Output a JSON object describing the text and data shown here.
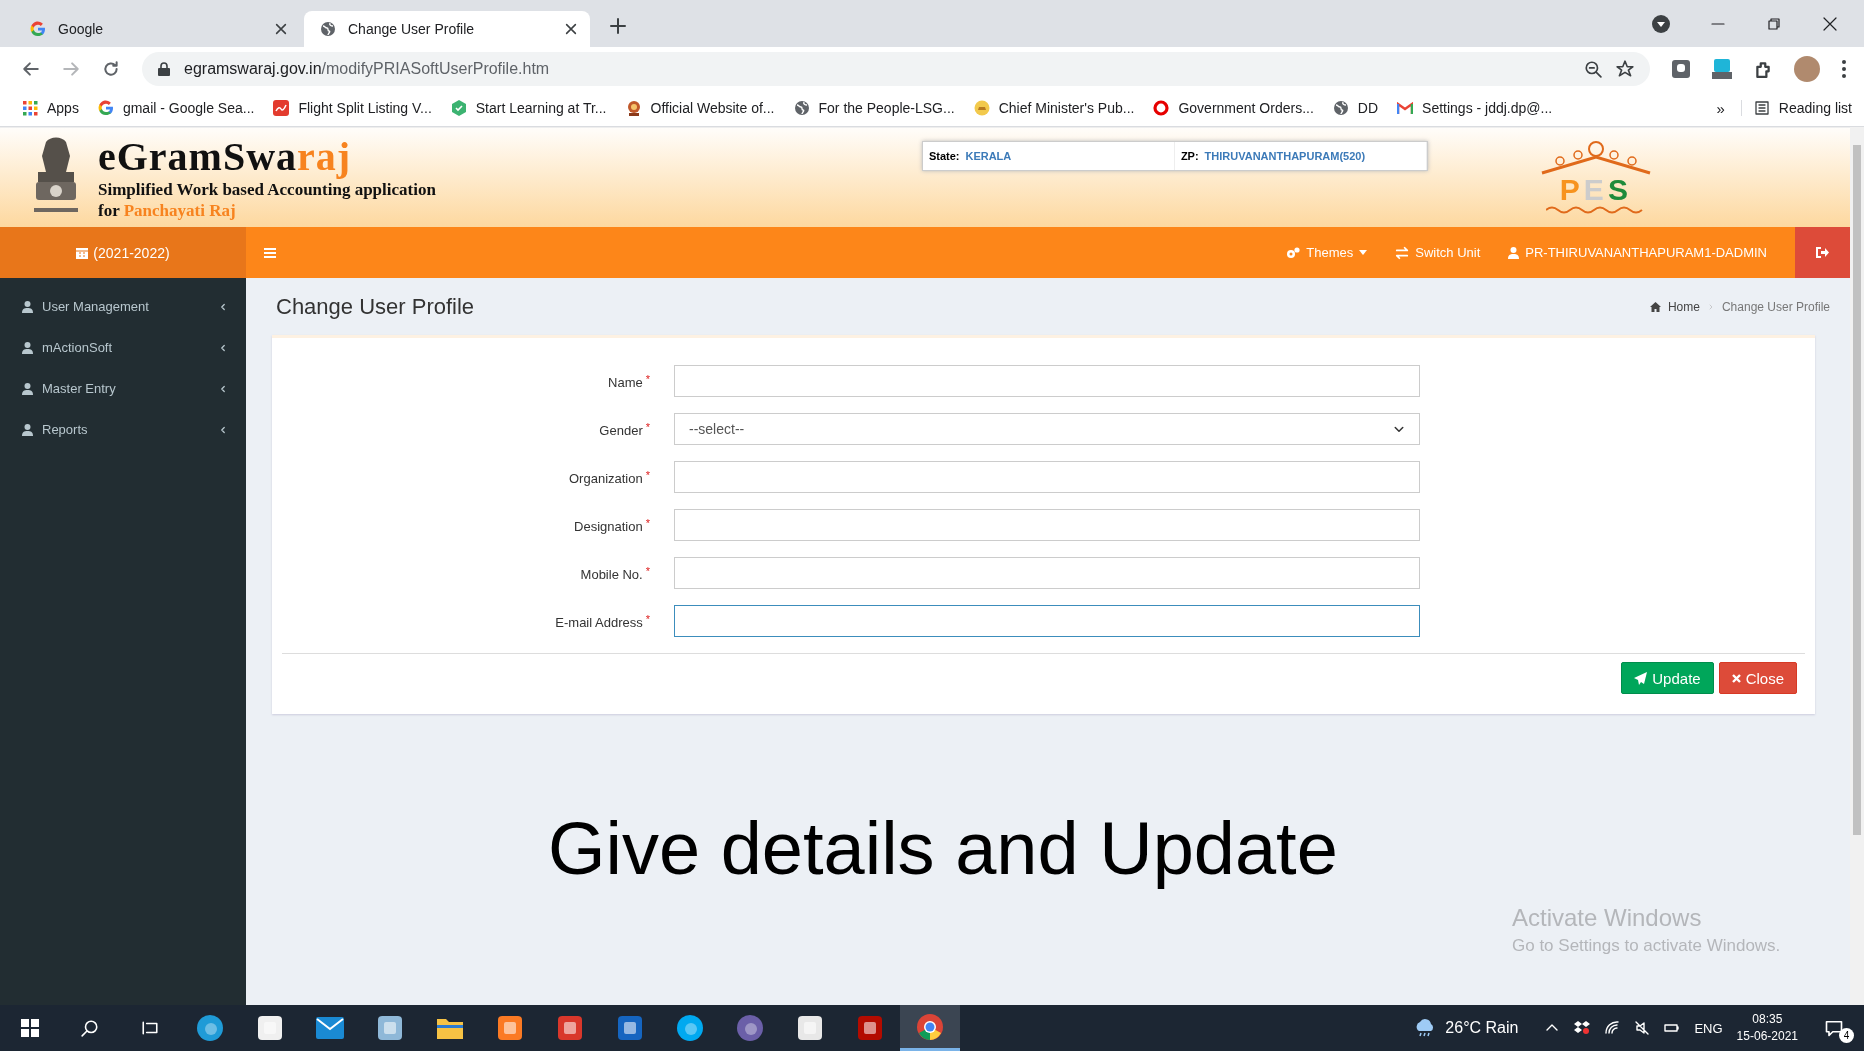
{
  "browser": {
    "tabs": [
      {
        "title": "Google",
        "kind": "google",
        "selected": false
      },
      {
        "title": "Change User Profile",
        "kind": "globe",
        "selected": true
      }
    ],
    "url": {
      "domain": "egramswaraj.gov.in",
      "path": "/modifyPRIASoftUserProfile.htm"
    },
    "bookmarks": [
      {
        "label": "Apps",
        "kind": "apps"
      },
      {
        "label": "gmail - Google Sea...",
        "kind": "google"
      },
      {
        "label": "Flight Split Listing V...",
        "kind": "square"
      },
      {
        "label": "Start Learning at Tr...",
        "kind": "hexagon"
      },
      {
        "label": "Official Website of...",
        "kind": "seal"
      },
      {
        "label": "For the People-LSG...",
        "kind": "globe"
      },
      {
        "label": "Chief Minister's Pub...",
        "kind": "coin"
      },
      {
        "label": "Government Orders...",
        "kind": "ring"
      },
      {
        "label": "DD",
        "kind": "globe"
      },
      {
        "label": "Settings - jddj.dp@...",
        "kind": "mail"
      }
    ],
    "bookmarks_more": "»",
    "reading_list": "Reading list"
  },
  "header": {
    "logo_main": "eGramSwa",
    "logo_accent": "raj",
    "tagline": "Simplified Work based Accounting application",
    "tagline_prefix": "for",
    "tagline_accent": "Panchayati Raj",
    "state_label": "State:",
    "state_value": "KERALA",
    "zp_label": "ZP:",
    "zp_value": "THIRUVANANTHAPURAM(520)",
    "pes_logo": "PES"
  },
  "nav": {
    "year": "(2021-2022)",
    "items": [
      {
        "label": "Themes",
        "kind": "dropdown"
      },
      {
        "label": "Switch Unit",
        "kind": "switch"
      },
      {
        "label": "PR-THIRUVANANTHAPURAM1-DADMIN",
        "kind": "user"
      }
    ]
  },
  "sidebar": {
    "items": [
      {
        "label": "User Management"
      },
      {
        "label": "mActionSoft"
      },
      {
        "label": "Master Entry"
      },
      {
        "label": "Reports"
      }
    ]
  },
  "page": {
    "title": "Change User Profile",
    "breadcrumb": [
      "Home",
      "Change User Profile"
    ]
  },
  "form": {
    "fields": [
      {
        "label": "Name",
        "mark": "*",
        "kind": "text",
        "focused": false
      },
      {
        "label": "Gender",
        "mark": "*",
        "kind": "select",
        "value": "--select--",
        "focused": false
      },
      {
        "label": "Organization",
        "mark": "*",
        "kind": "text",
        "focused": false
      },
      {
        "label": "Designation",
        "mark": "*",
        "kind": "text",
        "focused": false
      },
      {
        "label": "Mobile No.",
        "mark": "*",
        "kind": "text",
        "focused": false
      },
      {
        "label": "E-mail Address",
        "mark": "*",
        "kind": "text",
        "focused": true
      }
    ],
    "buttons": [
      {
        "label": "Update",
        "kind": "primary"
      },
      {
        "label": "Close",
        "kind": "danger"
      }
    ]
  },
  "caption": "Give details and Update",
  "os_watermark": {
    "title": "Activate Windows",
    "text": "Go to Settings to activate Windows."
  },
  "taskbar": {
    "apps": [
      {
        "kind": "edge",
        "selected": false
      },
      {
        "kind": "store",
        "selected": false
      },
      {
        "kind": "mail",
        "selected": false
      },
      {
        "kind": "notes",
        "selected": false
      },
      {
        "kind": "folder",
        "selected": false
      },
      {
        "kind": "xampp",
        "selected": false
      },
      {
        "kind": "shield",
        "selected": false
      },
      {
        "kind": "video",
        "selected": false
      },
      {
        "kind": "skype",
        "selected": false
      },
      {
        "kind": "orb",
        "selected": false
      },
      {
        "kind": "reader",
        "selected": false
      },
      {
        "kind": "pdf",
        "selected": false
      },
      {
        "kind": "chrome",
        "selected": true
      }
    ],
    "weather": "26°C Rain",
    "language": "ENG",
    "time": "08:35",
    "date": "15-06-2021",
    "notifications": "4"
  }
}
